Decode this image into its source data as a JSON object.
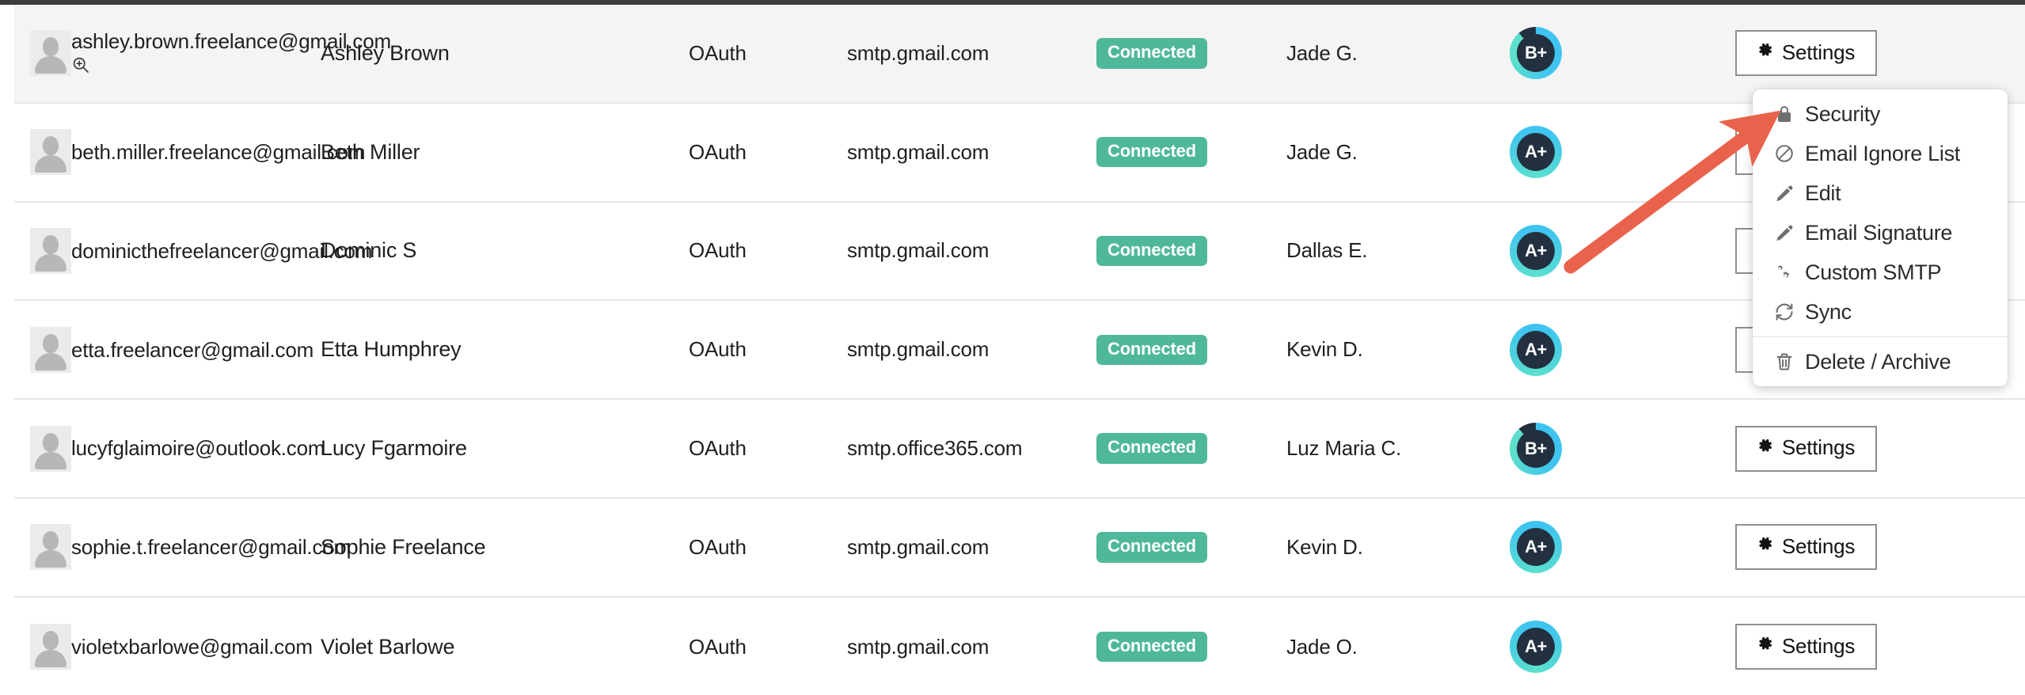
{
  "colors": {
    "accent_badge": "#4fb89a",
    "avatar_inner": "#22303f",
    "ring_start": "#3fc4ef",
    "ring_end": "#5ce0cd",
    "arrow": "#e9624b",
    "active_row": "#f4f4f4",
    "top_strip": "#3c3c3c",
    "border": "#e6e6e6"
  },
  "table": {
    "settings_label": "Settings",
    "settings_icon": "gear-icon",
    "magnify_icon": "zoom-in-icon",
    "rows": [
      {
        "avatar_icon": "user-placeholder-icon",
        "email": "ashley.brown.freelance@gmail.com",
        "has_magnifier": true,
        "name": "Ashley Brown",
        "auth": "OAuth",
        "smtp": "smtp.gmail.com",
        "status": "Connected",
        "owner": "Jade G.",
        "score": "B+",
        "score_complete": false,
        "active": true
      },
      {
        "avatar_icon": "user-placeholder-icon",
        "email": "beth.miller.freelance@gmail.com",
        "has_magnifier": false,
        "name": "Beth Miller",
        "auth": "OAuth",
        "smtp": "smtp.gmail.com",
        "status": "Connected",
        "owner": "Jade G.",
        "score": "A+",
        "score_complete": true,
        "active": false
      },
      {
        "avatar_icon": "user-placeholder-icon",
        "email": "dominicthefreelancer@gmail.com",
        "has_magnifier": false,
        "name": "Dominic S",
        "auth": "OAuth",
        "smtp": "smtp.gmail.com",
        "status": "Connected",
        "owner": "Dallas E.",
        "score": "A+",
        "score_complete": true,
        "active": false
      },
      {
        "avatar_icon": "user-placeholder-icon",
        "email": "etta.freelancer@gmail.com",
        "has_magnifier": false,
        "name": "Etta Humphrey",
        "auth": "OAuth",
        "smtp": "smtp.gmail.com",
        "status": "Connected",
        "owner": "Kevin D.",
        "score": "A+",
        "score_complete": true,
        "active": false
      },
      {
        "avatar_icon": "user-placeholder-icon",
        "email": "lucyfglaimoire@outlook.com",
        "has_magnifier": false,
        "name": "Lucy Fgarmoire",
        "auth": "OAuth",
        "smtp": "smtp.office365.com",
        "status": "Connected",
        "owner": "Luz Maria C.",
        "score": "B+",
        "score_complete": false,
        "active": false
      },
      {
        "avatar_icon": "user-placeholder-icon",
        "email": "sophie.t.freelancer@gmail.com",
        "has_magnifier": false,
        "name": "Sophie Freelance",
        "auth": "OAuth",
        "smtp": "smtp.gmail.com",
        "status": "Connected",
        "owner": "Kevin D.",
        "score": "A+",
        "score_complete": true,
        "active": false
      },
      {
        "avatar_icon": "user-placeholder-icon",
        "email": "violetxbarlowe@gmail.com",
        "has_magnifier": false,
        "name": "Violet Barlowe",
        "auth": "OAuth",
        "smtp": "smtp.gmail.com",
        "status": "Connected",
        "owner": "Jade O.",
        "score": "A+",
        "score_complete": true,
        "active": false
      }
    ]
  },
  "dropdown": {
    "items": [
      {
        "label": "Security",
        "icon": "lock-icon"
      },
      {
        "label": "Email Ignore List",
        "icon": "ban-icon"
      },
      {
        "label": "Edit",
        "icon": "pencil-icon"
      },
      {
        "label": "Email Signature",
        "icon": "pencil-icon"
      },
      {
        "label": "Custom SMTP",
        "icon": "gears-icon"
      },
      {
        "label": "Sync",
        "icon": "sync-icon"
      },
      {
        "separator_before": true,
        "label": "Delete / Archive",
        "icon": "trash-icon"
      }
    ]
  },
  "annotation": {
    "arrow_icon": "red-arrow-pointer",
    "points_to": "Security"
  }
}
